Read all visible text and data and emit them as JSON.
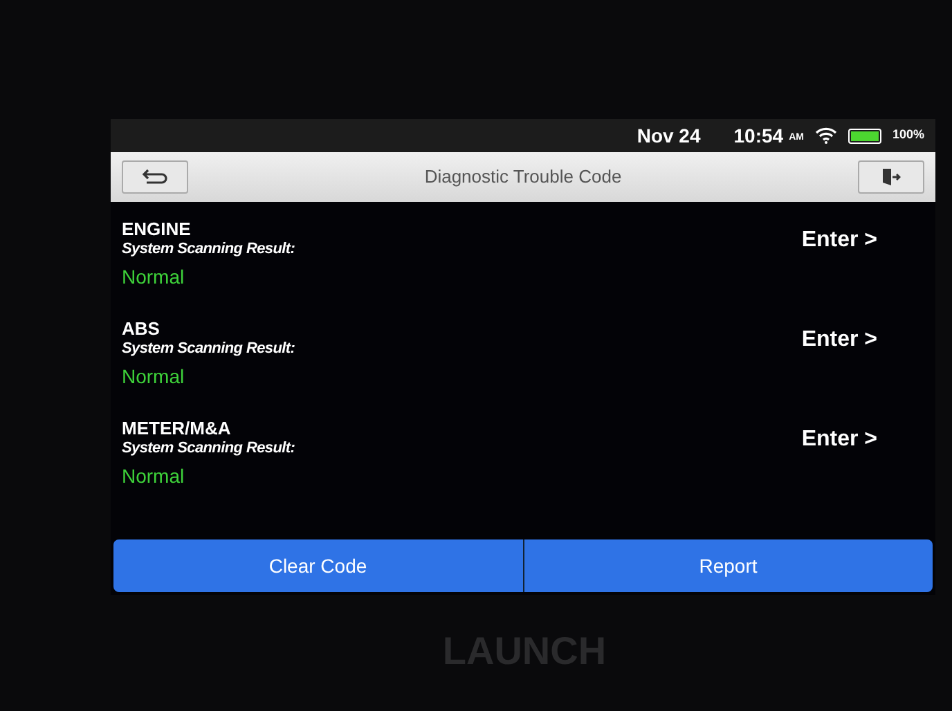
{
  "status_bar": {
    "date": "Nov 24",
    "time": "10:54",
    "meridiem": "AM",
    "battery_reading": "100%",
    "battery": {
      "level": 1
    }
  },
  "title_bar": {
    "title": "Diagnostic Trouble Code"
  },
  "systems": [
    {
      "name": "ENGINE",
      "label": "System Scanning Result:",
      "result": "Normal",
      "action": "Enter >"
    },
    {
      "name": "ABS",
      "label": "System Scanning Result:",
      "result": "Normal",
      "action": "Enter >"
    },
    {
      "name": "METER/M&A",
      "label": "System Scanning Result:",
      "result": "Normal",
      "action": "Enter >"
    }
  ],
  "buttons": [
    "Clear Code",
    "Report"
  ],
  "device": {
    "brand": "LAUNCH"
  }
}
